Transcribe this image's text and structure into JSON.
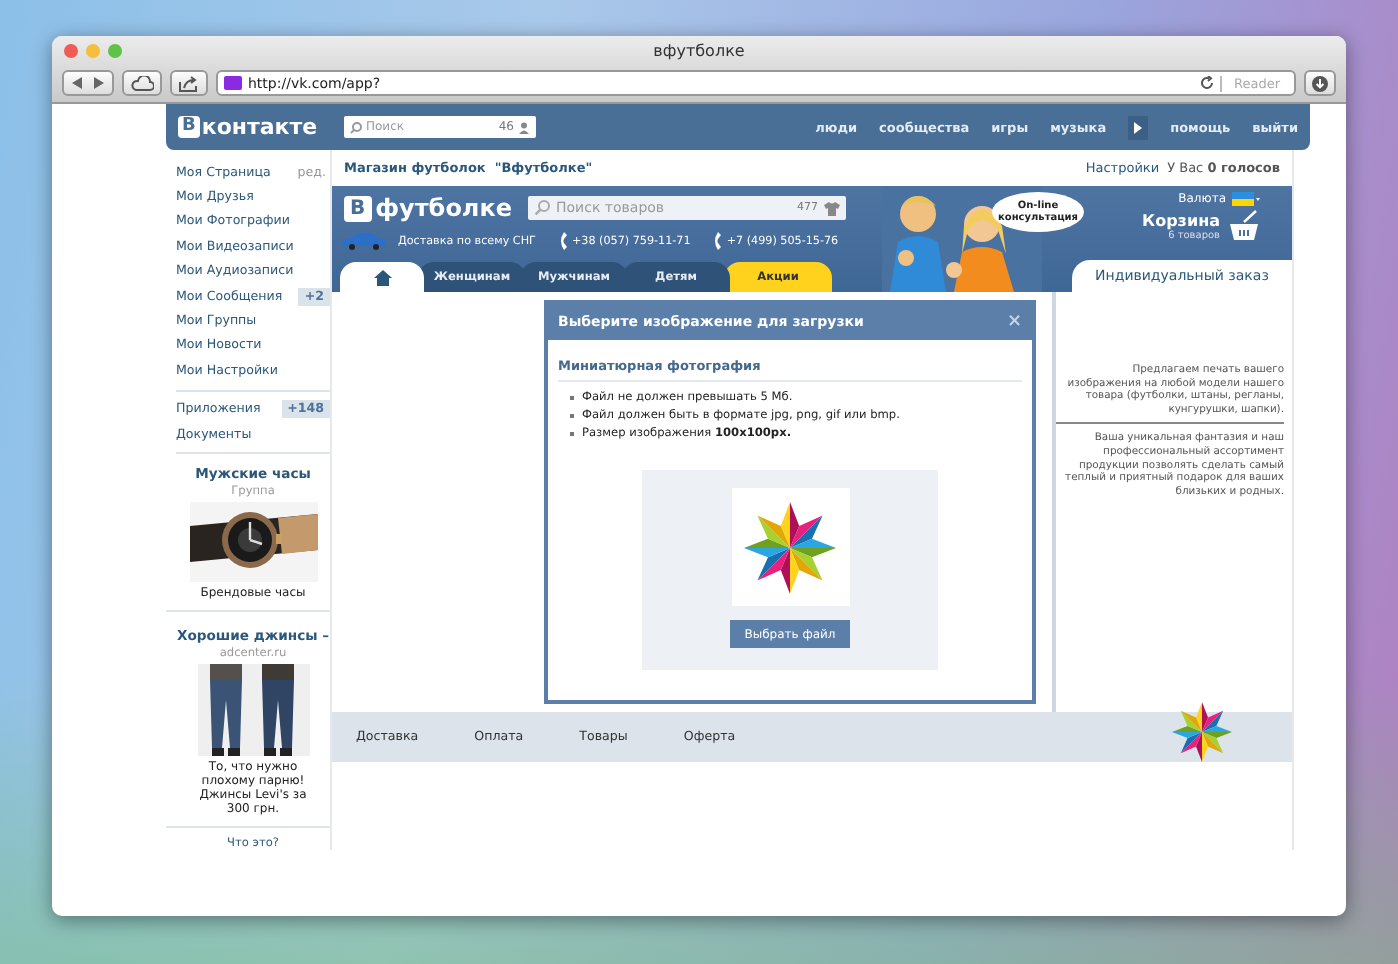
{
  "browser": {
    "title": "вфутболке",
    "url": "http://vk.com/app?",
    "reader_button": "Reader"
  },
  "vk_header": {
    "logo_letter": "В",
    "logo_text": "контакте",
    "search": {
      "placeholder": "Поиск",
      "count": "46"
    },
    "nav_left": [
      "люди",
      "сообщества",
      "игры",
      "музыка"
    ],
    "nav_right": [
      "помощь",
      "выйти"
    ]
  },
  "sidebar": {
    "edit_link": "ред.",
    "menu": [
      {
        "label": "Моя Страница"
      },
      {
        "label": "Мои Друзья"
      },
      {
        "label": "Мои Фотографии"
      },
      {
        "label": "Мои Видеозаписи"
      },
      {
        "label": "Мои Аудиозаписи"
      },
      {
        "label": "Мои Сообщения",
        "badge": "+2"
      },
      {
        "label": "Мои Группы"
      },
      {
        "label": "Мои Новости"
      },
      {
        "label": "Мои Настройки"
      }
    ],
    "apps": [
      {
        "label": "Приложения",
        "badge": "+148"
      },
      {
        "label": "Документы"
      }
    ],
    "ads": [
      {
        "title": "Мужские часы",
        "subtitle": "Группа",
        "caption": "Брендовые часы"
      },
      {
        "title": "Хорошие джинсы –",
        "subtitle": "adcenter.ru",
        "caption": "То, что нужно плохому парню! Джинсы Levi's за 300 грн."
      }
    ],
    "about_link": "Что это?"
  },
  "app": {
    "title": "Магазин футболок  \"Вфутболке\"",
    "settings_link": "Настройки",
    "votes": "У Вас **0 голосов**",
    "banner": {
      "logo_letter": "В",
      "logo_text": "футболке",
      "search": {
        "placeholder": "Поиск товаров",
        "count": "477"
      },
      "delivery": "Доставка по всему СНГ",
      "phones": [
        "+38 (057) 759-11-71",
        "+7 (499) 505-15-76"
      ],
      "bubble": "On-line консультация",
      "currency": "Валюта",
      "cart": "Корзина",
      "cart_count": "6 товаров",
      "tabs": [
        {
          "kind": "home",
          "selected": true
        },
        {
          "kind": "category",
          "label": "Женщинам",
          "selected": false
        },
        {
          "kind": "category",
          "label": "Мужчинам",
          "selected": false
        },
        {
          "kind": "category",
          "label": "Детям",
          "selected": false
        },
        {
          "kind": "promo",
          "label": "Акции",
          "selected": false
        }
      ],
      "custom_order": "Индивидуальный заказ"
    },
    "dialog": {
      "title": "Выберите изображение для загрузки",
      "close": "×",
      "section": "Миниатюрная фотография",
      "rules": [
        "Файл не должен превышать 5 Мб.",
        "Файл должен быть в формате jpg, png, gif или bmp.",
        "Размер изображения **100x100px.**"
      ],
      "button": "Выбрать файл"
    },
    "info": [
      "Предлагаем печать вашего изображения на любой модели нашего товара (футболки, штаны, регланы, кунгурушки, шапки).",
      "Ваша уникальная фантазия и наш профессиональный ассортимент продукции позволять сделать самый теплый и приятный подарок для ваших близьких и родных."
    ],
    "footer_nav": [
      "Доставка",
      "Оплата",
      "Товары",
      "Оферта"
    ]
  }
}
